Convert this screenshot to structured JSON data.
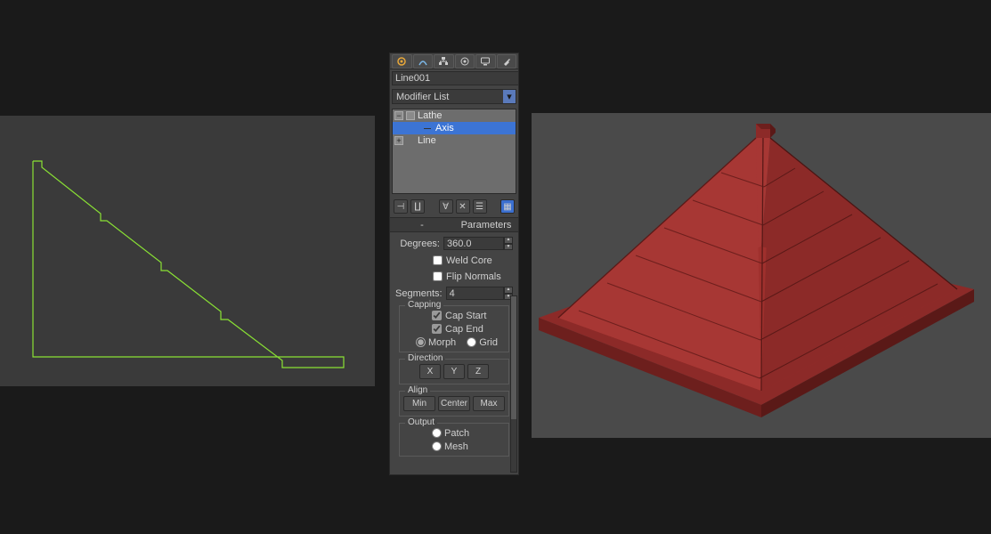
{
  "object_name": "Line001",
  "object_color": "#8fe36b",
  "modifier_list_label": "Modifier List",
  "stack": {
    "items": [
      {
        "label": "Lathe",
        "expandable": true,
        "selected": false
      },
      {
        "label": "Axis",
        "child": true,
        "selected": true
      },
      {
        "label": "Line",
        "expandable": true,
        "selected": false
      }
    ]
  },
  "rollout": {
    "title": "Parameters",
    "degrees_label": "Degrees:",
    "degrees_value": "360.0",
    "weld_core": "Weld Core",
    "flip_normals": "Flip Normals",
    "segments_label": "Segments:",
    "segments_value": "4",
    "capping": {
      "title": "Capping",
      "cap_start": "Cap Start",
      "cap_end": "Cap End",
      "morph": "Morph",
      "grid": "Grid"
    },
    "direction": {
      "title": "Direction",
      "x": "X",
      "y": "Y",
      "z": "Z"
    },
    "align": {
      "title": "Align",
      "min": "Min",
      "center": "Center",
      "max": "Max"
    },
    "output": {
      "title": "Output",
      "patch": "Patch",
      "mesh": "Mesh"
    }
  }
}
